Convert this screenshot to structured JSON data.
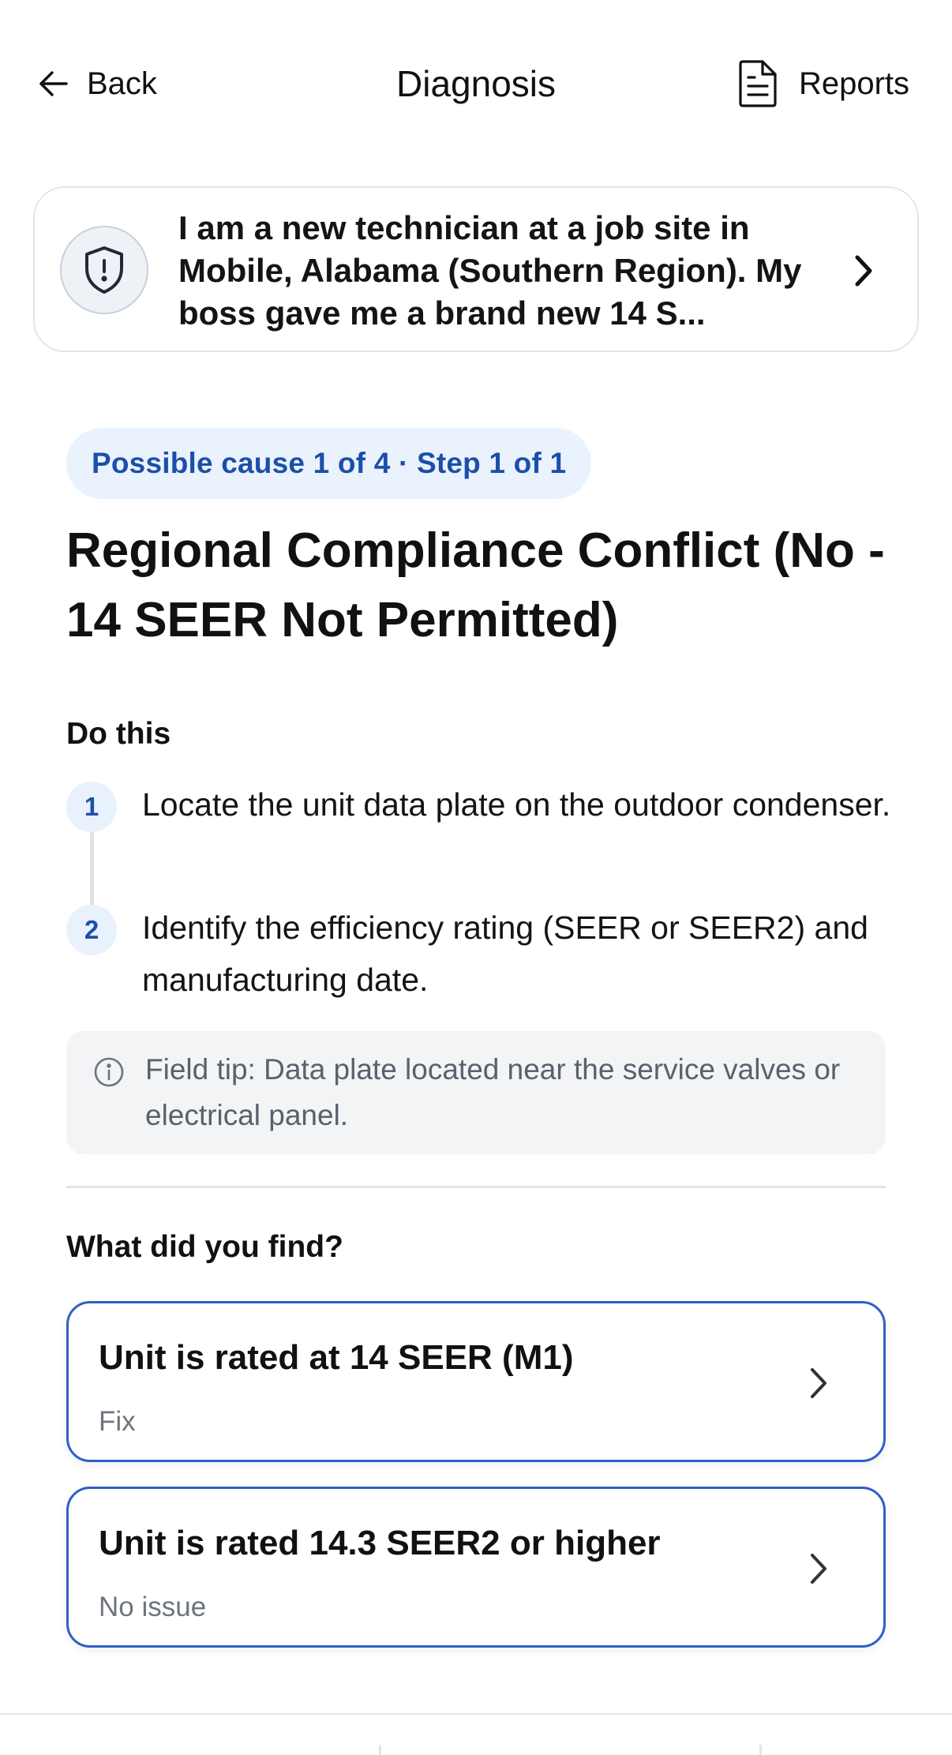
{
  "header": {
    "back_label": "Back",
    "title": "Diagnosis",
    "reports_label": "Reports"
  },
  "problem": {
    "text": "I am a new technician at a job site in Mobile, Alabama (Southern Region). My boss gave me a brand new 14 S..."
  },
  "badge": "Possible cause 1 of 4 · Step 1 of 1",
  "cause_title": "Regional Compliance Conflict (No - 14 SEER Not Permitted)",
  "do_this_label": "Do this",
  "steps": [
    {
      "num": "1",
      "text": "Locate the unit data plate on the outdoor condenser."
    },
    {
      "num": "2",
      "text": "Identify the efficiency rating (SEER or SEER2) and manufacturing date."
    }
  ],
  "tip": "Field tip: Data plate located near the service valves or electrical panel.",
  "question_label": "What did you find?",
  "options": [
    {
      "title": "Unit is rated at 14 SEER (M1)",
      "subtitle": "Fix"
    },
    {
      "title": "Unit is rated 14.3 SEER2 or higher",
      "subtitle": "No issue"
    }
  ],
  "colors": {
    "accent": "#2f5fc4",
    "badge_bg": "#eaf2fd",
    "badge_text": "#1c4fa8"
  }
}
